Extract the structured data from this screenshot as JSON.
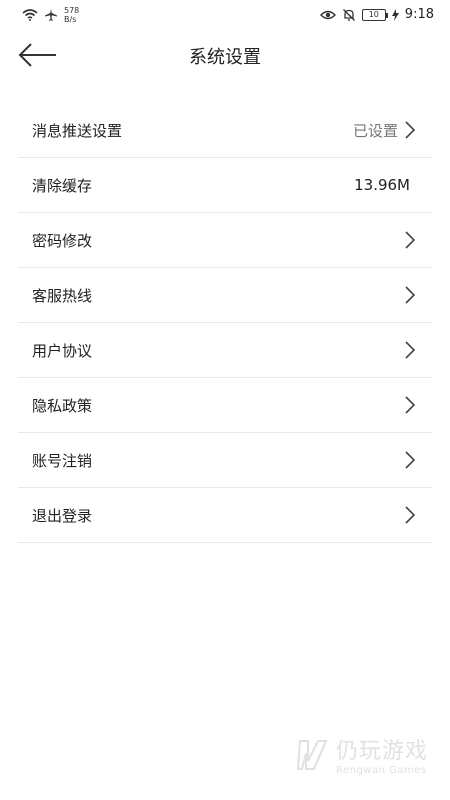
{
  "status_bar": {
    "net_speed_value": "578",
    "net_speed_unit": "B/s",
    "battery": "10",
    "time": "9:18"
  },
  "header": {
    "title": "系统设置"
  },
  "settings": [
    {
      "label": "消息推送设置",
      "value": "已设置",
      "chevron": true
    },
    {
      "label": "清除缓存",
      "value": "13.96M",
      "chevron": false
    },
    {
      "label": "密码修改",
      "value": "",
      "chevron": true
    },
    {
      "label": "客服热线",
      "value": "",
      "chevron": true
    },
    {
      "label": "用户协议",
      "value": "",
      "chevron": true
    },
    {
      "label": "隐私政策",
      "value": "",
      "chevron": true
    },
    {
      "label": "账号注销",
      "value": "",
      "chevron": true
    },
    {
      "label": "退出登录",
      "value": "",
      "chevron": true
    }
  ],
  "watermark": {
    "cn": "仍玩游戏",
    "en": "Rengwan Games"
  }
}
